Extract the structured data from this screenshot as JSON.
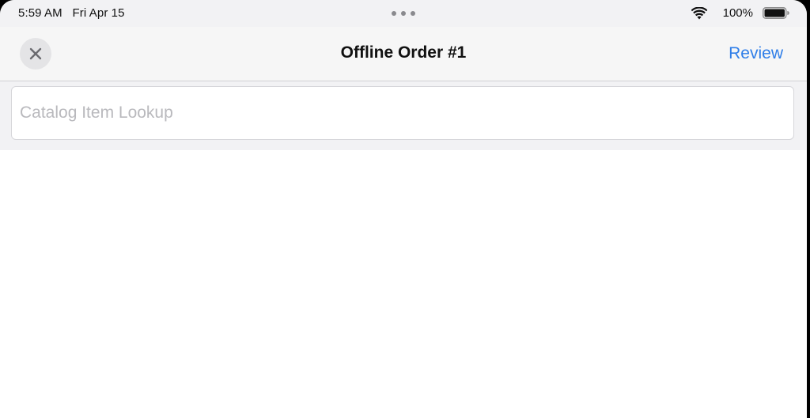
{
  "status_bar": {
    "time": "5:59 AM",
    "date": "Fri Apr 15",
    "battery_percent": "100%",
    "battery_level": 1.0,
    "icons": [
      "wifi-icon",
      "battery-icon",
      "multitask-dots-icon"
    ]
  },
  "nav_bar": {
    "close_icon": "close-icon",
    "title": "Offline Order #1",
    "review_label": "Review"
  },
  "search": {
    "placeholder": "Catalog Item Lookup",
    "value": ""
  },
  "colors": {
    "accent": "#2f7ee8",
    "nav_background": "#f6f6f6",
    "placeholder": "#b9b9bd"
  }
}
